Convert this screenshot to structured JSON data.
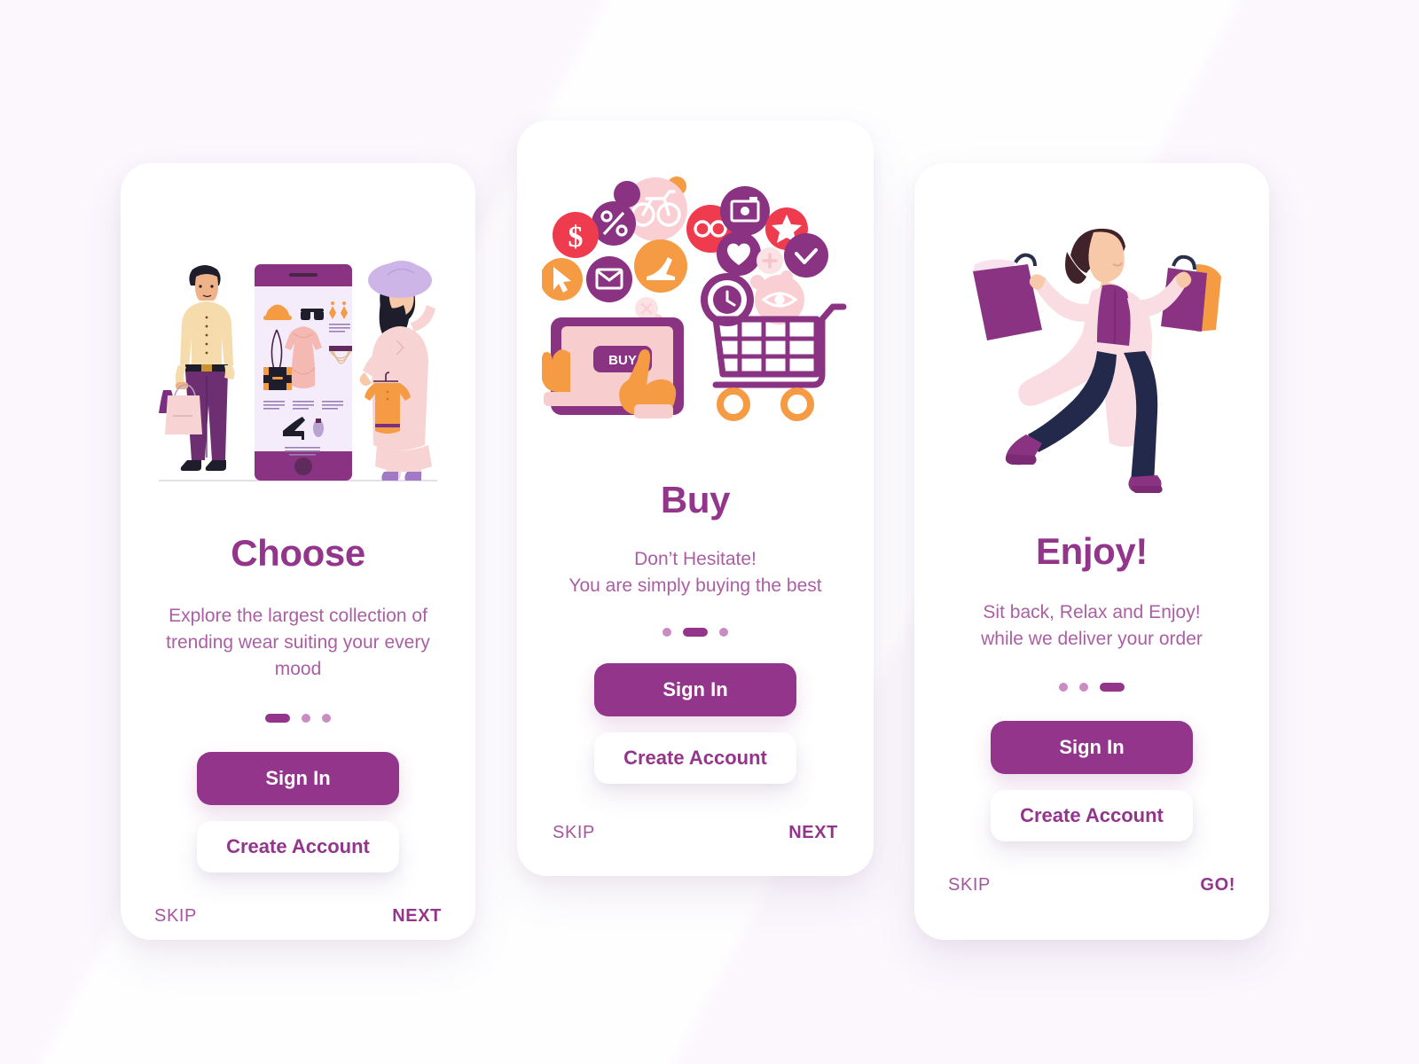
{
  "theme": {
    "background": "#fbf7fd",
    "card_background": "#ffffff",
    "primary_purple": "#93368b",
    "subtitle_purple": "#ab5fa3",
    "dot_inactive": "#c98dc2",
    "accent_orange": "#f59b43",
    "accent_red": "#ee3b4e",
    "accent_pink": "#f9cfd4"
  },
  "screens": [
    {
      "id": "choose",
      "illustration": "shoppers-browsing-phone-illustration",
      "title": "Choose",
      "subtitle": "Explore the largest collection of trending wear suiting your every mood",
      "pagination": {
        "total": 3,
        "active_index": 0
      },
      "primary_button": "Sign In",
      "secondary_button": "Create Account",
      "skip_label": "SKIP",
      "action_label": "NEXT"
    },
    {
      "id": "buy",
      "illustration": "tablet-buy-cart-icons-illustration",
      "title": "Buy",
      "subtitle": "Don’t Hesitate!\nYou are simply buying the best",
      "subtitle_line1": "Don’t Hesitate!",
      "subtitle_line2": "You are simply buying the best",
      "pagination": {
        "total": 3,
        "active_index": 1
      },
      "primary_button": "Sign In",
      "secondary_button": "Create Account",
      "skip_label": "SKIP",
      "action_label": "NEXT",
      "tablet_button_label": "BUY"
    },
    {
      "id": "enjoy",
      "illustration": "woman-running-with-shopping-bags-illustration",
      "title": "Enjoy!",
      "subtitle": "Sit back, Relax and Enjoy!\nwhile we deliver your order",
      "subtitle_line1": "Sit back, Relax and Enjoy!",
      "subtitle_line2": "while we deliver your order",
      "pagination": {
        "total": 3,
        "active_index": 2
      },
      "primary_button": "Sign In",
      "secondary_button": "Create Account",
      "skip_label": "SKIP",
      "action_label": "GO!"
    }
  ],
  "icon_arc": [
    "dollar-icon",
    "percent-icon",
    "bicycle-icon",
    "camera-icon",
    "star-icon",
    "shoe-icon",
    "mail-icon",
    "cursor-icon",
    "glasses-icon",
    "heart-icon",
    "check-icon",
    "clock-icon",
    "eye-icon",
    "plus-icon",
    "close-icon"
  ],
  "phone_items": [
    "hat-item",
    "sunglasses-item",
    "earrings-item",
    "handbag-item",
    "dress-item",
    "necklace-item",
    "heels-item",
    "perfume-item"
  ]
}
